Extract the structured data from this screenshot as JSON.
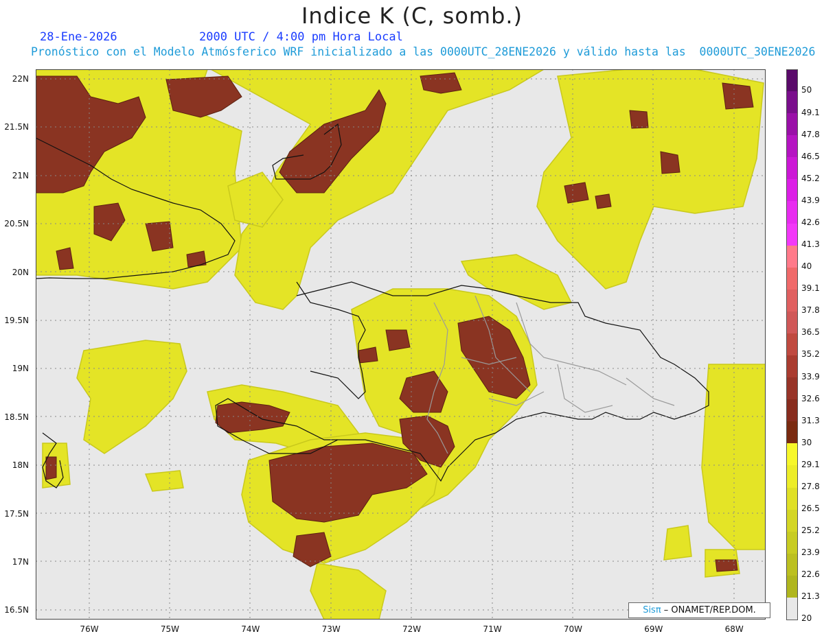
{
  "header": {
    "title": "Indice K (C, somb.)",
    "date": "28-Ene-2026",
    "time": "2000 UTC / 4:00 pm Hora Local",
    "description": "Pronóstico con el Modelo Atmósferico WRF inicializado a las 0000UTC_28ENE2026 y válido hasta las  0000UTC_30ENE2026"
  },
  "map": {
    "lat_labels": [
      "22N",
      "21.5N",
      "21N",
      "20.5N",
      "20N",
      "19.5N",
      "19N",
      "18.5N",
      "18N",
      "17.5N",
      "17N",
      "16.5N"
    ],
    "lon_labels": [
      "76W",
      "75W",
      "74W",
      "73W",
      "72W",
      "71W",
      "70W",
      "69W",
      "68W"
    ],
    "background_color": "#e8e8e8"
  },
  "colorbar": {
    "labels": [
      "50",
      "49.1",
      "47.8",
      "46.5",
      "45.2",
      "43.9",
      "42.6",
      "41.3",
      "40",
      "39.1",
      "37.8",
      "36.5",
      "35.2",
      "33.9",
      "32.6",
      "31.3",
      "30",
      "29.1",
      "27.8",
      "26.5",
      "25.2",
      "23.9",
      "22.6",
      "21.3",
      "20"
    ],
    "colors": [
      "#5a0a6a",
      "#7a0e8c",
      "#9a10a8",
      "#b514c2",
      "#cc18d6",
      "#dc1fe6",
      "#e82cf0",
      "#f238f8",
      "#ff7a8a",
      "#f06a6a",
      "#e06060",
      "#d05858",
      "#c04a40",
      "#aa3c30",
      "#983428",
      "#882c1e",
      "#7a2a10",
      "#f7f72a",
      "#eded28",
      "#e0e026",
      "#d4d624",
      "#c8cc22",
      "#bcc020",
      "#b0b61e",
      "#e8e8e8"
    ]
  },
  "credit": {
    "sis": "Sisπ",
    "org": " – ONAMET/REP.DOM."
  }
}
